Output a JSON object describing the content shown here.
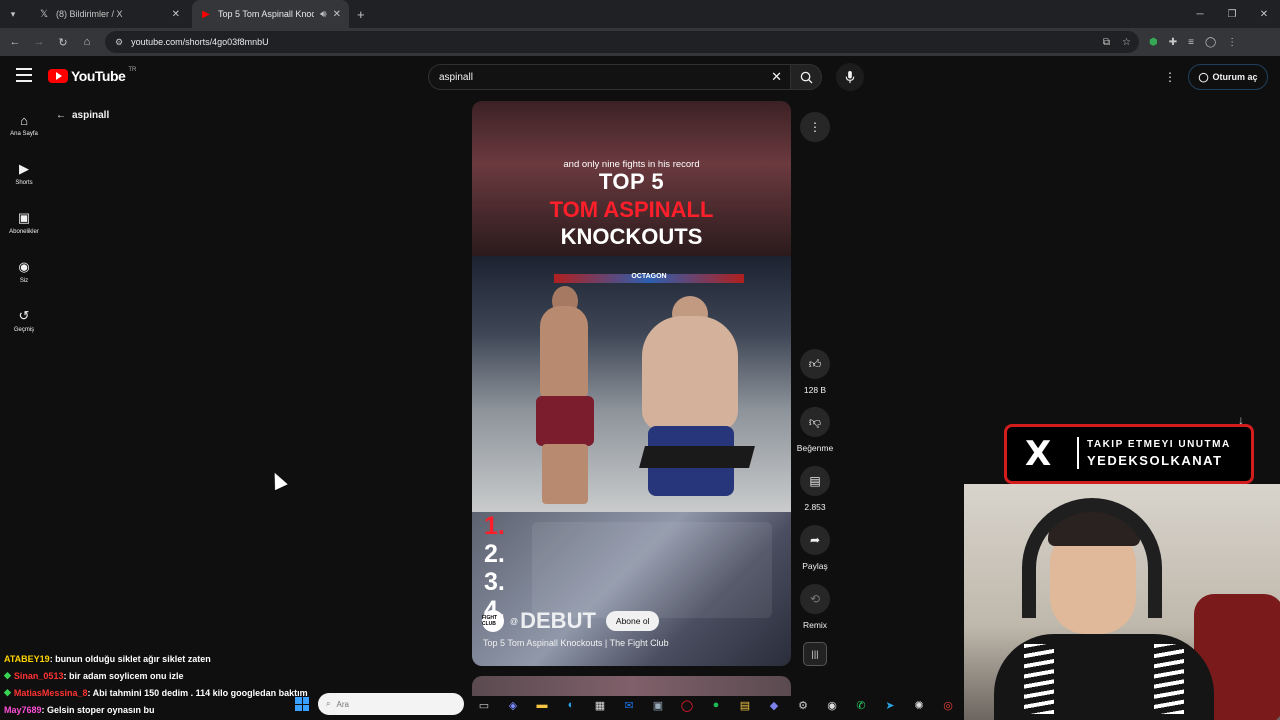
{
  "browser": {
    "tabs": [
      {
        "title": "(8) Bildirimler / X",
        "icon": "x-logo-icon"
      },
      {
        "title": "Top 5 Tom Aspinall Knocko",
        "icon": "youtube-icon",
        "audio": "speaker-icon"
      }
    ],
    "url": "youtube.com/shorts/4go03f8mnbU"
  },
  "youtube": {
    "logo_text": "YouTube",
    "region": "TR",
    "search_value": "aspinall",
    "signin_label": "Oturum aç",
    "guide": [
      {
        "icon": "home-icon",
        "label": "Ana Sayfa"
      },
      {
        "icon": "shorts-icon",
        "label": "Shorts"
      },
      {
        "icon": "subscriptions-icon",
        "label": "Abonelikler"
      },
      {
        "icon": "account-icon",
        "label": "Siz"
      },
      {
        "icon": "history-icon",
        "label": "Geçmiş"
      }
    ],
    "back_query": "aspinall"
  },
  "short": {
    "caption": "and only nine fights in his record",
    "title_line1": "TOP 5",
    "title_line2": "TOM ASPINALL",
    "title_line3": "KNOCKOUTS",
    "octagon_text": "OCTAGON",
    "ranks": [
      "1.",
      "2.",
      "3.",
      "4."
    ],
    "channel_avatar_text": "FIGHT CLUB",
    "channel_handle": "@",
    "overlay_word": "DEBUT",
    "subscribe_label": "Abone ol",
    "video_title": "Top 5 Tom Aspinall Knockouts | The Fight Club",
    "actions": {
      "like_count": "128 B",
      "dislike_label": "Beğenme",
      "comment_count": "2.853",
      "share_label": "Paylaş",
      "remix_label": "Remix"
    }
  },
  "stream_overlay": {
    "line1": "TAKIP ETMEYI UNUTMA",
    "line2": "YEDEKSOLKANAT",
    "accent": "#d11d1d"
  },
  "chat": [
    {
      "user": "ATABEY19",
      "text": ": bunun olduğu siklet ağır siklet zaten",
      "style": "yellow"
    },
    {
      "user": "Sinan_0513",
      "text": ": bir adam soylicem onu izle",
      "style": "red",
      "badge": true
    },
    {
      "user": "MatiasMessina_8",
      "text": ": Abi tahmini 150 dedim . 114 kilo googledan baktım",
      "style": "red",
      "badge": true
    },
    {
      "user": "May7689",
      "text": ": Gelsin stoper oynasın bu",
      "style": "vip"
    }
  ],
  "taskbar": {
    "search_placeholder": "Ara"
  }
}
